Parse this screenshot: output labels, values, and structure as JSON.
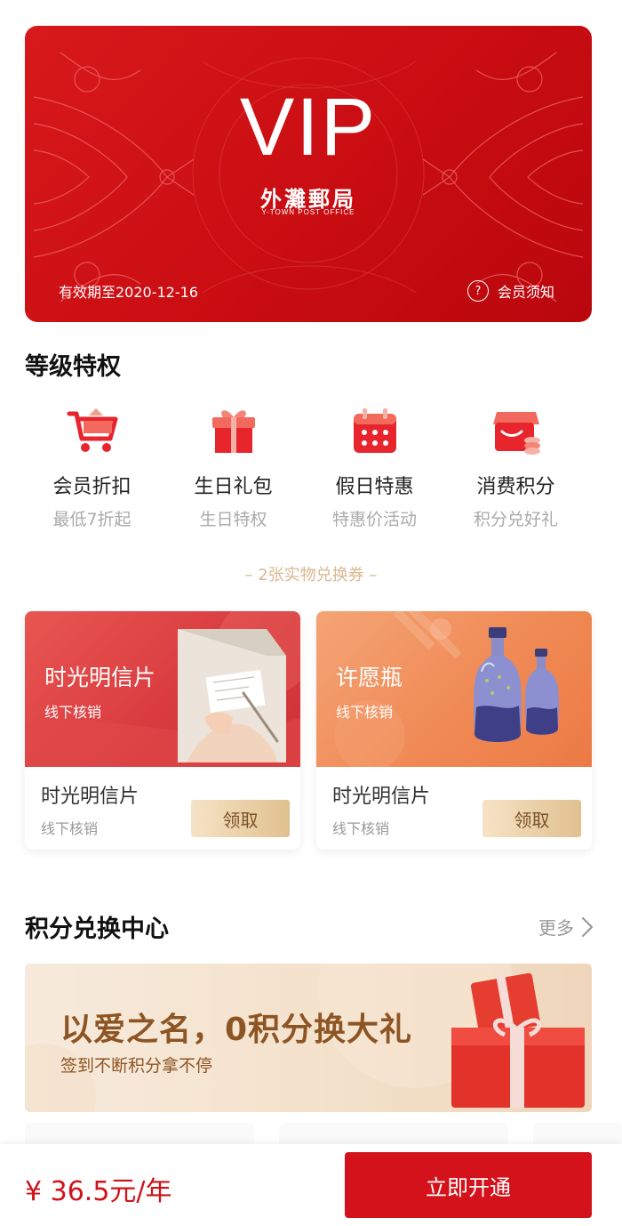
{
  "vip_card": {
    "title": "VIP",
    "brand_cn": "外灘郵局",
    "brand_en": "Y-TOWN POST OFFICE",
    "validity": "有效期至2020-12-16",
    "notice_icon_text": "?",
    "notice": "会员须知",
    "accent": "#d0131a"
  },
  "privileges": {
    "title": "等级特权",
    "items": [
      {
        "icon": "shopping-cart-icon",
        "name": "会员折扣",
        "sub": "最低7折起"
      },
      {
        "icon": "gift-box-icon",
        "name": "生日礼包",
        "sub": "生日特权"
      },
      {
        "icon": "calendar-icon",
        "name": "假日特惠",
        "sub": "特惠价活动"
      },
      {
        "icon": "points-shop-icon",
        "name": "消费积分",
        "sub": "积分兑好礼"
      }
    ]
  },
  "coupons": {
    "header": "– 2张实物兑换券 –",
    "items": [
      {
        "banner_title": "时光明信片",
        "banner_sub": "线下核销",
        "title": "时光明信片",
        "sub": "线下核销",
        "button": "领取"
      },
      {
        "banner_title": "许愿瓶",
        "banner_sub": "线下核销",
        "title": "时光明信片",
        "sub": "线下核销",
        "button": "领取"
      }
    ]
  },
  "points_center": {
    "title": "积分兑换中心",
    "more": "更多",
    "promo_title": "以爱之名，0积分换大礼",
    "promo_sub": "签到不断积分拿不停"
  },
  "bottom": {
    "price": "¥ 36.5元/年",
    "button": "立即开通"
  }
}
